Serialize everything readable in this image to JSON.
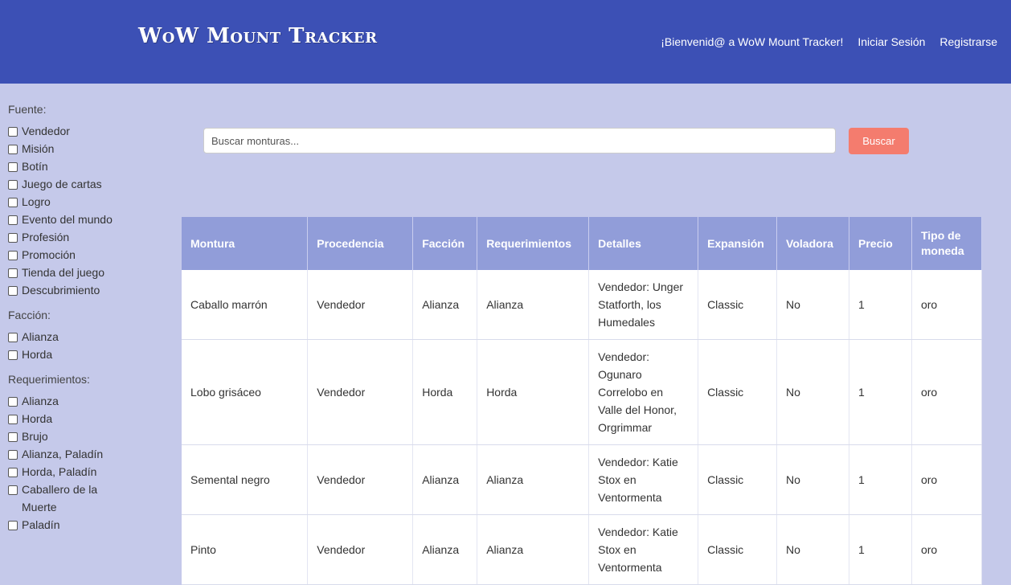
{
  "header": {
    "brand": "WoW Mount Tracker",
    "welcome": "¡Bienvenid@ a WoW Mount Tracker!",
    "login": "Iniciar Sesión",
    "register": "Registrarse"
  },
  "filters": {
    "source": {
      "title": "Fuente:",
      "options": [
        "Vendedor",
        "Misión",
        "Botín",
        "Juego de cartas",
        "Logro",
        "Evento del mundo",
        "Profesión",
        "Promoción",
        "Tienda del juego",
        "Descubrimiento"
      ]
    },
    "faction": {
      "title": "Facción:",
      "options": [
        "Alianza",
        "Horda"
      ]
    },
    "requirements": {
      "title": "Requerimientos:",
      "options": [
        "Alianza",
        "Horda",
        "Brujo",
        "Alianza, Paladín",
        "Horda, Paladín",
        "Caballero de la Muerte",
        "Paladín"
      ]
    }
  },
  "search": {
    "placeholder": "Buscar monturas...",
    "button": "Buscar"
  },
  "table": {
    "headers": [
      "Montura",
      "Procedencia",
      "Facción",
      "Requerimientos",
      "Detalles",
      "Expansión",
      "Voladora",
      "Precio",
      "Tipo de moneda"
    ],
    "rows": [
      [
        "Caballo marrón",
        "Vendedor",
        "Alianza",
        "Alianza",
        "Vendedor: Unger Statforth, los Humedales",
        "Classic",
        "No",
        "1",
        "oro"
      ],
      [
        "Lobo grisáceo",
        "Vendedor",
        "Horda",
        "Horda",
        "Vendedor: Ogunaro Correlobo en Valle del Honor, Orgrimmar",
        "Classic",
        "No",
        "1",
        "oro"
      ],
      [
        "Semental negro",
        "Vendedor",
        "Alianza",
        "Alianza",
        "Vendedor: Katie Stox en Ventormenta",
        "Classic",
        "No",
        "1",
        "oro"
      ],
      [
        "Pinto",
        "Vendedor",
        "Alianza",
        "Alianza",
        "Vendedor: Katie Stox en Ventormenta",
        "Classic",
        "No",
        "1",
        "oro"
      ]
    ]
  }
}
